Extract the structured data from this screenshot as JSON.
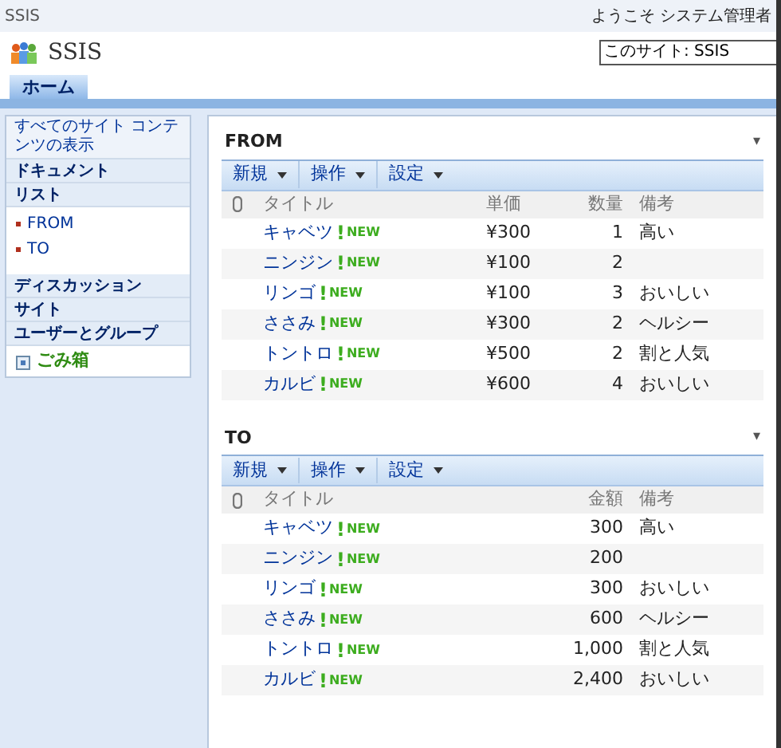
{
  "top_bar": {
    "site": "SSIS",
    "welcome": "ようこそ システム管理者"
  },
  "header": {
    "title": "SSIS",
    "scope": "このサイト: SSIS"
  },
  "tabs": [
    {
      "label": "ホーム",
      "selected": true
    }
  ],
  "sidebar": {
    "items": [
      {
        "kind": "link",
        "label": "すべてのサイト コンテンツの表示"
      },
      {
        "kind": "heading",
        "label": "ドキュメント"
      },
      {
        "kind": "heading",
        "label": "リスト",
        "children": [
          {
            "label": "FROM"
          },
          {
            "label": "TO"
          }
        ]
      },
      {
        "kind": "heading",
        "label": "ディスカッション"
      },
      {
        "kind": "heading",
        "label": "サイト"
      },
      {
        "kind": "heading",
        "label": "ユーザーとグループ"
      },
      {
        "kind": "recycle",
        "label": "ごみ箱"
      }
    ]
  },
  "lists": [
    {
      "title": "FROM",
      "menu": "▾",
      "toolbar": [
        "新規",
        "操作",
        "設定"
      ],
      "columns": [
        {
          "kind": "title",
          "label": "タイトル"
        },
        {
          "kind": "price",
          "label": "単価"
        },
        {
          "kind": "qty",
          "label": "数量"
        },
        {
          "kind": "text",
          "label": "備考"
        }
      ],
      "rows": [
        {
          "cells": [
            "キャベツ",
            "¥300",
            "1",
            "高い"
          ],
          "new_mark": "!",
          "new_label": "NEW"
        },
        {
          "cells": [
            "ニンジン",
            "¥100",
            "2",
            ""
          ],
          "new_mark": "!",
          "new_label": "NEW"
        },
        {
          "cells": [
            "リンゴ",
            "¥100",
            "3",
            "おいしい"
          ],
          "new_mark": "!",
          "new_label": "NEW"
        },
        {
          "cells": [
            "ささみ",
            "¥300",
            "2",
            "ヘルシー"
          ],
          "new_mark": "!",
          "new_label": "NEW"
        },
        {
          "cells": [
            "トントロ",
            "¥500",
            "2",
            "割と人気"
          ],
          "new_mark": "!",
          "new_label": "NEW"
        },
        {
          "cells": [
            "カルビ",
            "¥600",
            "4",
            "おいしい"
          ],
          "new_mark": "!",
          "new_label": "NEW"
        }
      ]
    },
    {
      "title": "TO",
      "menu": "▾",
      "toolbar": [
        "新規",
        "操作",
        "設定"
      ],
      "columns": [
        {
          "kind": "title",
          "label": "タイトル"
        },
        {
          "kind": "amount",
          "label": "金額"
        },
        {
          "kind": "text",
          "label": "備考"
        }
      ],
      "rows": [
        {
          "cells": [
            "キャベツ",
            "300",
            "高い"
          ],
          "new_mark": "!",
          "new_label": "NEW"
        },
        {
          "cells": [
            "ニンジン",
            "200",
            ""
          ],
          "new_mark": "!",
          "new_label": "NEW"
        },
        {
          "cells": [
            "リンゴ",
            "300",
            "おいしい"
          ],
          "new_mark": "!",
          "new_label": "NEW"
        },
        {
          "cells": [
            "ささみ",
            "600",
            "ヘルシー"
          ],
          "new_mark": "!",
          "new_label": "NEW"
        },
        {
          "cells": [
            "トントロ",
            "1,000",
            "割と人気"
          ],
          "new_mark": "!",
          "new_label": "NEW"
        },
        {
          "cells": [
            "カルビ",
            "2,400",
            "おいしい"
          ],
          "new_mark": "!",
          "new_label": "NEW"
        }
      ]
    }
  ]
}
